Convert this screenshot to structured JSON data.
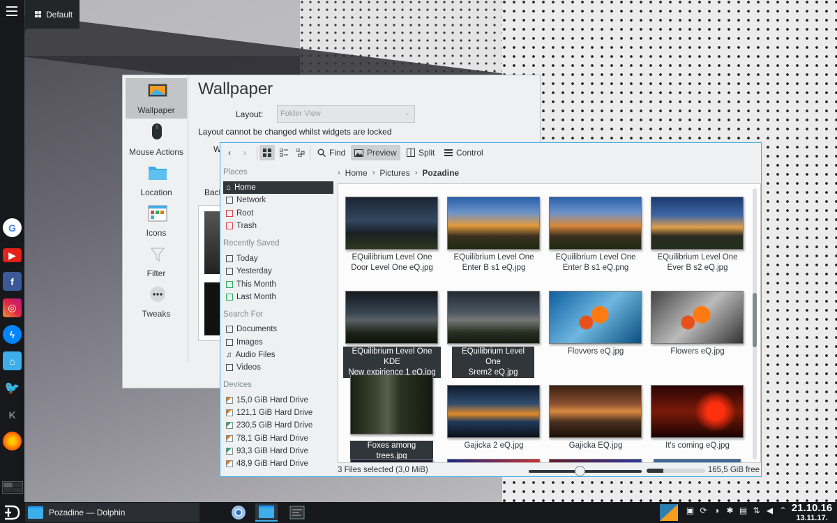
{
  "activity": {
    "label": "Default"
  },
  "launchers": [
    "google-icon",
    "youtube-icon",
    "facebook-icon",
    "instagram-icon",
    "messenger-icon",
    "home-folder-icon",
    "twitter-icon",
    "kde-icon",
    "firefox-icon"
  ],
  "settings": {
    "title": "Wallpaper",
    "sidebar": [
      {
        "label": "Wallpaper",
        "icon": "wallpaper-icon",
        "selected": true
      },
      {
        "label": "Mouse Actions",
        "icon": "mouse-icon",
        "selected": false
      },
      {
        "label": "Location",
        "icon": "folder-icon",
        "selected": false
      },
      {
        "label": "Icons",
        "icon": "icons-icon",
        "selected": false
      },
      {
        "label": "Filter",
        "icon": "filter-icon",
        "selected": false
      },
      {
        "label": "Tweaks",
        "icon": "tweaks-icon",
        "selected": false
      }
    ],
    "layout_label": "Layout:",
    "layout_value": "Folder View",
    "lock_text": "Layout cannot be changed whilst widgets are locked",
    "w_label": "W",
    "back_label": "Back"
  },
  "dolphin": {
    "toolbar": {
      "find": "Find",
      "preview": "Preview",
      "split": "Split",
      "control": "Control"
    },
    "places": {
      "places_header": "Places",
      "places": [
        "Home",
        "Network",
        "Root",
        "Trash"
      ],
      "recent_header": "Recently Saved",
      "recent": [
        "Today",
        "Yesterday",
        "This Month",
        "Last Month"
      ],
      "search_header": "Search For",
      "search": [
        "Documents",
        "Images",
        "Audio Files",
        "Videos"
      ],
      "devices_header": "Devices",
      "devices": [
        "15,0 GiB Hard Drive",
        "121,1 GiB Hard Drive",
        "230,5 GiB Hard Drive",
        "78,1 GiB Hard Drive",
        "93,3 GiB Hard Drive",
        "48,9 GiB Hard Drive"
      ]
    },
    "breadcrumb": [
      "Home",
      "Pictures",
      "Pozadine"
    ],
    "files": [
      {
        "line1": "EQuilibrium Level One",
        "line2": "Door Level One eQ.jpg",
        "selected": false
      },
      {
        "line1": "EQuilibrium Level One",
        "line2": "Enter B s1 eQ.jpg",
        "selected": false
      },
      {
        "line1": "EQuilibrium Level One",
        "line2": "Enter B s1 eQ.png",
        "selected": false
      },
      {
        "line1": "EQuilibrium Level One",
        "line2": "Ever B s2 eQ.jpg",
        "selected": false
      },
      {
        "line1": "EQuilibrium Level One KDE",
        "line2": "New expirience 1 eQ.jpg",
        "selected": true
      },
      {
        "line1": "EQuilibrium Level One",
        "line2": "Srem2 eQ.jpg",
        "selected": true
      },
      {
        "line1": "Flovvers eQ.jpg",
        "line2": "",
        "selected": false
      },
      {
        "line1": "Flowers eQ.jpg",
        "line2": "",
        "selected": false
      },
      {
        "line1": "Foxes among trees.jpg",
        "line2": "",
        "selected": true
      },
      {
        "line1": "Gajicka 2 eQ.jpg",
        "line2": "",
        "selected": false
      },
      {
        "line1": "Gajicka EQ.jpg",
        "line2": "",
        "selected": false
      },
      {
        "line1": "It's coming eQ.jpg",
        "line2": "",
        "selected": false
      }
    ],
    "status": {
      "selection": "3 Files selected (3,0 MiB)",
      "free": "165,5 GiB free",
      "zoom_fraction": 0.45,
      "used_fraction": 0.28
    }
  },
  "taskbar": {
    "task_label": "Pozadine — Dolphin",
    "time": "21.10.16",
    "date": "13.11.17."
  },
  "colors": {
    "accent": "#3daee9",
    "panel": "#16181b",
    "selection": "#31363b"
  }
}
